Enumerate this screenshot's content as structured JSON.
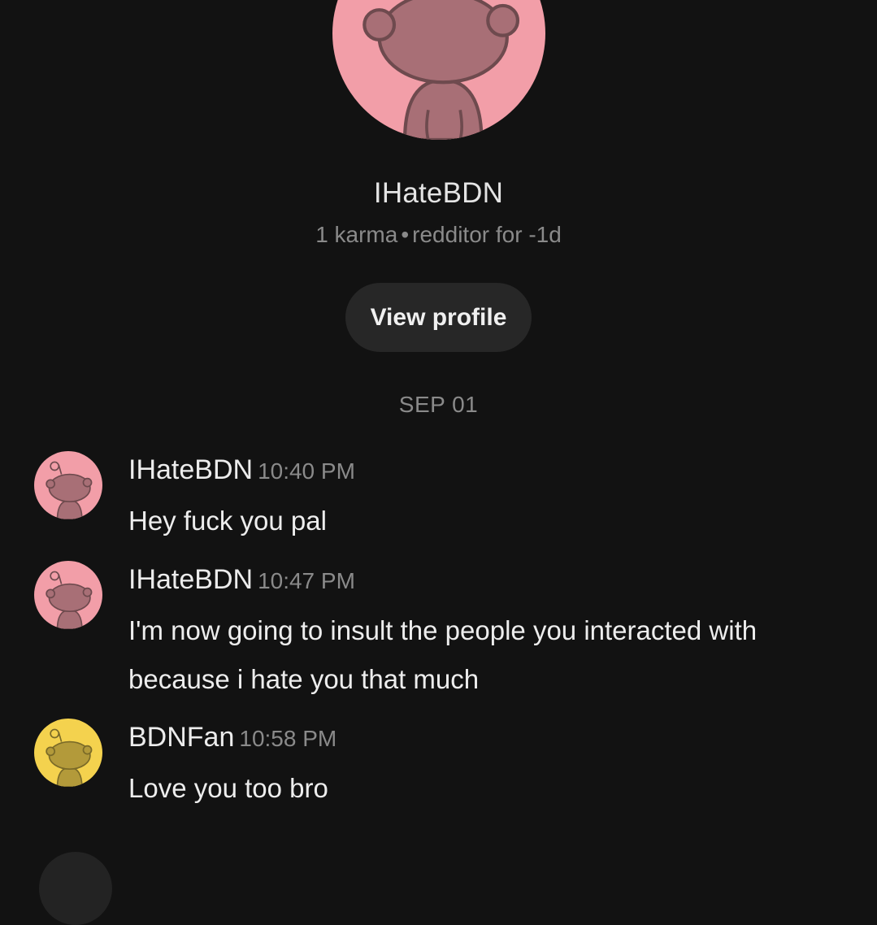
{
  "profile": {
    "username": "IHateBDN",
    "karma": "1 karma",
    "separator": "•",
    "age": "redditor for -1d",
    "view_profile_label": "View profile",
    "avatar_color": "#f29ea8",
    "avatar_icon": "snoo-avatar-icon"
  },
  "date_separator": "SEP 01",
  "messages": [
    {
      "author": "IHateBDN",
      "time": "10:40 PM",
      "text": "Hey fuck you pal",
      "avatar_color": "#f29ea8"
    },
    {
      "author": "IHateBDN",
      "time": "10:47 PM",
      "text": "I'm now going to insult the people you interacted with because i hate you that much",
      "avatar_color": "#f29ea8"
    },
    {
      "author": "BDNFan",
      "time": "10:58 PM",
      "text": "Love you too bro",
      "avatar_color": "#f4d24e"
    }
  ]
}
